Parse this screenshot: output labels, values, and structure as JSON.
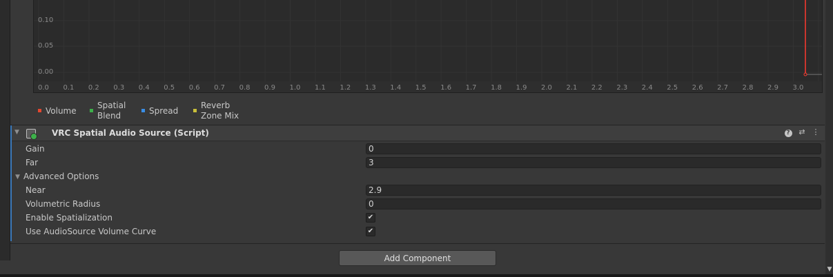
{
  "curve_graph": {
    "y_ticks": [
      "0.10",
      "0.05",
      "0.00"
    ],
    "x_ticks": [
      "0.0",
      "0.1",
      "0.2",
      "0.3",
      "0.4",
      "0.5",
      "0.6",
      "0.7",
      "0.8",
      "0.9",
      "1.0",
      "1.1",
      "1.2",
      "1.3",
      "1.4",
      "1.5",
      "1.6",
      "1.7",
      "1.8",
      "1.9",
      "2.0",
      "2.1",
      "2.2",
      "2.3",
      "2.4",
      "2.5",
      "2.6",
      "2.7",
      "2.8",
      "2.9",
      "3.0"
    ],
    "curve_color": "#ff3b30"
  },
  "legend": {
    "items": [
      {
        "label": "Volume",
        "color": "#e4472f"
      },
      {
        "label_line1": "Spatial",
        "label_line2": "Blend",
        "color": "#3db04a"
      },
      {
        "label": "Spread",
        "color": "#3a8ee6"
      },
      {
        "label_line1": "Reverb",
        "label_line2": "Zone Mix",
        "color": "#c9c03a"
      }
    ]
  },
  "component": {
    "title": "VRC Spatial Audio Source (Script)",
    "help_glyph": "?",
    "preset_glyph": "⇄",
    "menu_glyph": "⋮",
    "fold_glyph": "▼"
  },
  "properties": {
    "gain_label": "Gain",
    "gain_value": "0",
    "far_label": "Far",
    "far_value": "3",
    "advanced_label": "Advanced Options",
    "near_label": "Near",
    "near_value": "2.9",
    "volumetric_label": "Volumetric Radius",
    "volumetric_value": "0",
    "spatialization_label": "Enable Spatialization",
    "spatialization_checked": true,
    "curve_label": "Use AudioSource Volume Curve",
    "curve_checked": true,
    "check_glyph": "✔"
  },
  "footer": {
    "add_component_label": "Add Component"
  },
  "colors": {
    "accent_bar": "#3a79bb",
    "panel_bg": "#383838",
    "graph_bg": "#2b2b2b"
  }
}
